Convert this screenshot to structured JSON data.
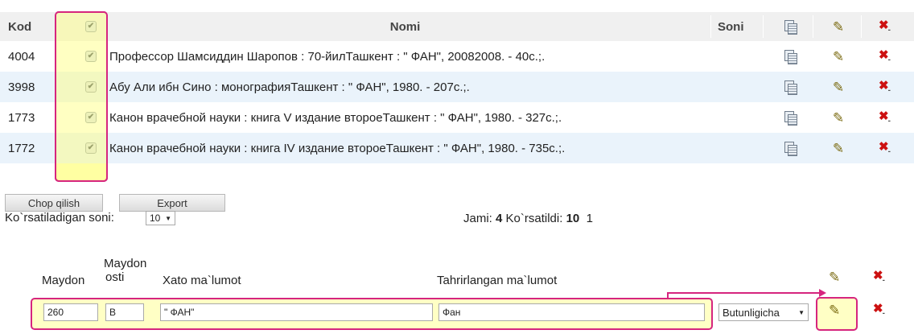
{
  "table": {
    "headers": {
      "kod": "Kod",
      "nomi": "Nomi",
      "soni": "Soni"
    },
    "rows": [
      {
        "kod": "4004",
        "nomi": "Профессор Шамсиддин Шаропов : 70-йилТашкент : \" ФАН\", 20082008. - 40с.;."
      },
      {
        "kod": "3998",
        "nomi": "Абу Али ибн Сино : монографияТашкент : \" ФАН\", 1980. - 207с.;."
      },
      {
        "kod": "1773",
        "nomi": "Канон врачебной науки : книга V издание второеТашкент : \" ФАН\", 1980. - 327с.;."
      },
      {
        "kod": "1772",
        "nomi": "Канон врачебной науки : книга IV издание второеТашкент : \" ФАН\", 1980. - 735с.;."
      }
    ]
  },
  "actions": {
    "print_label": "Chop qilish",
    "export_label": "Export"
  },
  "paging": {
    "show_label": "Ko`rsatiladigan soni:",
    "show_value": "10",
    "total_label": "Jami:",
    "total_value": "4",
    "shown_label": "Ko`rsatildi:",
    "shown_value": "10",
    "page": "1"
  },
  "editor": {
    "headers": {
      "maydon": "Maydon",
      "maydon_osti_1": "Maydon",
      "maydon_osti_2": "osti",
      "xato": "Xato ma`lumot",
      "tahrir": "Tahrirlangan ma`lumot"
    },
    "row": {
      "maydon": "260",
      "maydon_osti": "B",
      "xato": "\" ФАН\"",
      "tahrir": "Фан",
      "mode": "Butunligicha"
    }
  },
  "icons": {
    "copy": "copy-icon",
    "edit": "edit-pencil-icon",
    "delete": "delete-icon",
    "checkbox": "checkbox-checked-icon"
  },
  "colors": {
    "highlight_border": "#d6257e",
    "highlight_fill": "#ffff96",
    "row_alt": "#eaf3fb",
    "header_bg": "#f0f0f0"
  }
}
